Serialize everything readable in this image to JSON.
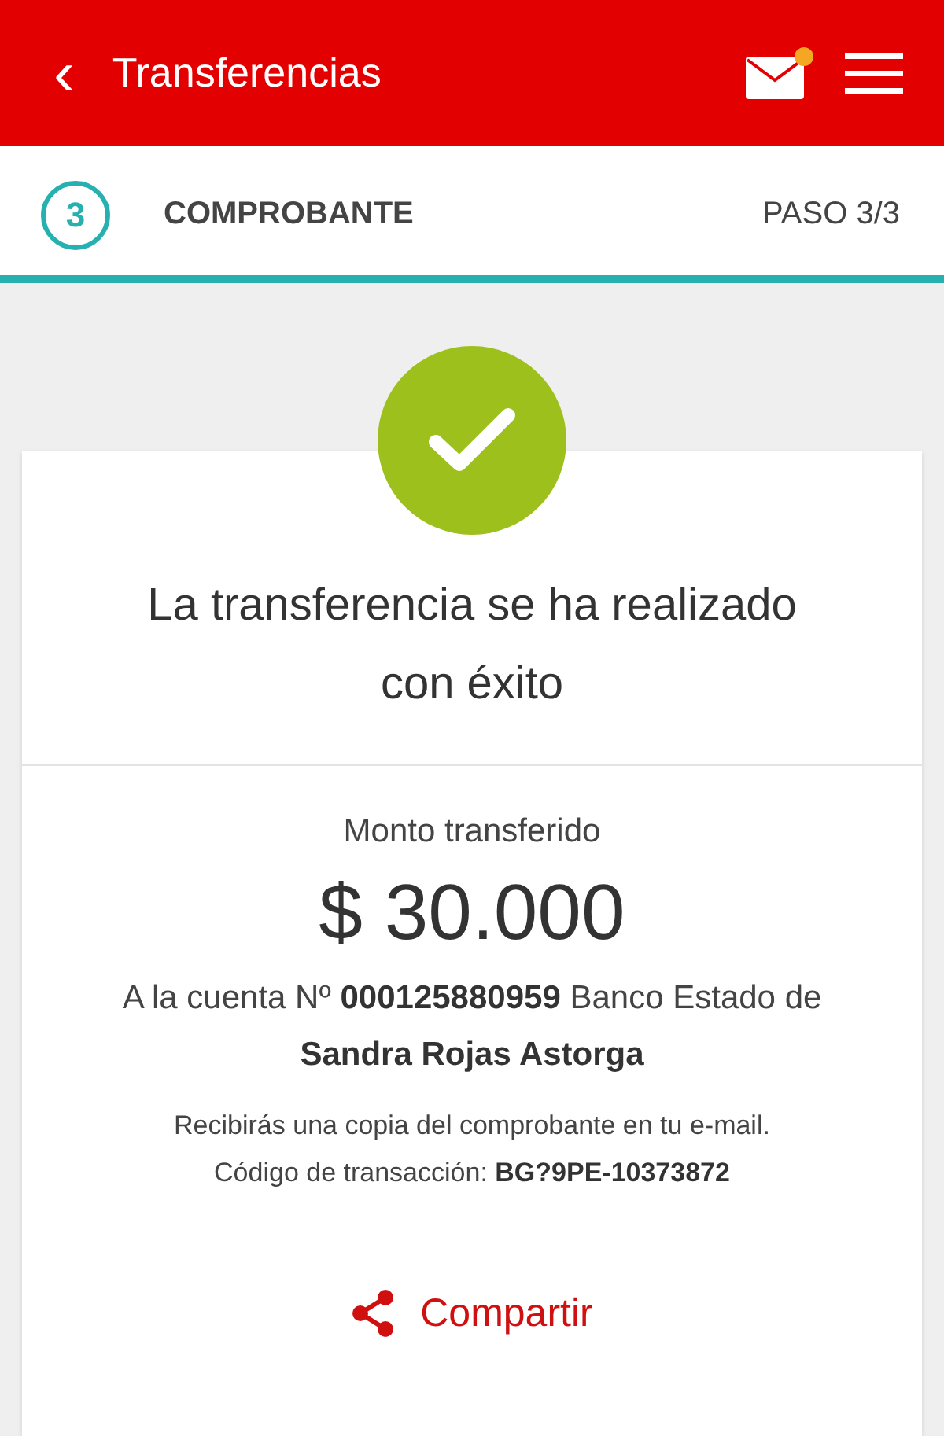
{
  "header": {
    "back": "‹",
    "title": "Transferencias",
    "mail": {
      "unread": true
    }
  },
  "step": {
    "number": "3",
    "label": "COMPROBANTE",
    "progress": "PASO 3/3",
    "level": 1
  },
  "result": {
    "success": true,
    "title": "La transferencia se ha realizado con éxito"
  },
  "details": {
    "amount_label": "Monto transferido",
    "amount": "$ 30.000",
    "account": "A la cuenta Nº **000125880959** Banco Estado de **Sandra Rojas Astorga**",
    "notice": "Recibirás una copia del comprobante en tu e-mail.",
    "transaction": "Código de transacción: **BG?9PE-10373872**"
  },
  "share": {
    "label": "Compartir"
  }
}
